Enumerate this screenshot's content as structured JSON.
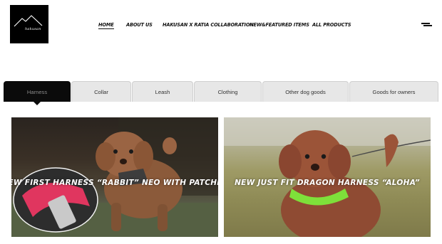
{
  "brand": {
    "logo_text": "hakusan"
  },
  "nav": {
    "items": [
      {
        "label": "HOME",
        "active": true
      },
      {
        "label": "ABOUT US",
        "active": false
      },
      {
        "label": "HAKUSAN X RATIA COLLABORATION",
        "active": false
      },
      {
        "label": "NEW&FEATURED ITEMS",
        "active": false
      },
      {
        "label": "ALL PRODUCTS",
        "active": false
      }
    ],
    "menu_icon": "hamburger-icon"
  },
  "tabs": [
    {
      "label": "Harness",
      "active": true
    },
    {
      "label": "Collar",
      "active": false
    },
    {
      "label": "Leash",
      "active": false
    },
    {
      "label": "Clothing",
      "active": false
    },
    {
      "label": "Other dog goods",
      "active": false
    },
    {
      "label": "Goods for owners",
      "active": false
    }
  ],
  "cards": [
    {
      "title": "NEW FIRST HARNESS “RABBIT” NEO WITH PATCHES"
    },
    {
      "title": "NEW JUST FIT DRAGON HARNESS “ALOHA”"
    }
  ],
  "colors": {
    "active_tab": "#0b0b0b",
    "tab_bg": "#e7e7e7",
    "accent_pink": "#e0365f",
    "accent_green": "#7ee03a"
  }
}
